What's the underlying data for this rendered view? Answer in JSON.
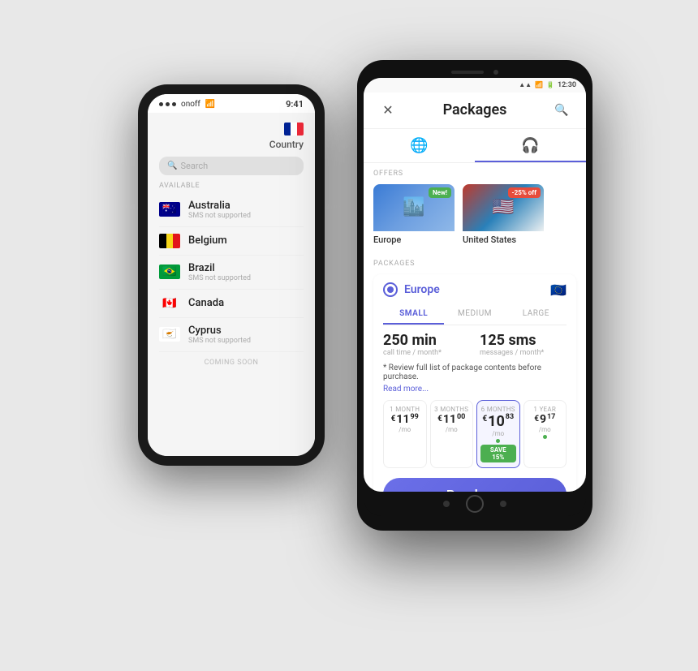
{
  "background": "#e8e8e8",
  "iphone": {
    "status": {
      "dots": 3,
      "carrier": "onoff",
      "wifi": true,
      "time": "9:41"
    },
    "header": {
      "country_label": "Country"
    },
    "search": {
      "placeholder": "Search"
    },
    "sections": {
      "available": "AVAILABLE",
      "coming_soon": "COMING SOON"
    },
    "countries": [
      {
        "name": "Australia",
        "sub": "SMS not supported",
        "flag": "au"
      },
      {
        "name": "Belgium",
        "sub": "",
        "flag": "be"
      },
      {
        "name": "Brazil",
        "sub": "SMS not supported",
        "flag": "br"
      },
      {
        "name": "Canada",
        "sub": "",
        "flag": "ca"
      },
      {
        "name": "Cyprus",
        "sub": "SMS not supported",
        "flag": "cy"
      }
    ]
  },
  "android": {
    "status": {
      "time": "12:30",
      "icons": [
        "signal",
        "wifi",
        "battery"
      ]
    },
    "nav": {
      "title": "Packages",
      "close_icon": "✕",
      "search_icon": "🔍"
    },
    "tabs": [
      {
        "id": "globe",
        "icon": "🌐",
        "active": false
      },
      {
        "id": "headset",
        "icon": "🎧",
        "active": true
      }
    ],
    "offers": {
      "section_label": "OFFERS",
      "items": [
        {
          "name": "Europe",
          "badge": "New!",
          "badge_type": "new",
          "bg": "europe"
        },
        {
          "name": "United States",
          "badge": "-25% off",
          "badge_type": "discount",
          "bg": "us"
        }
      ]
    },
    "packages": {
      "section_label": "PACKAGES",
      "selected": "Europe",
      "sizes": [
        "SMALL",
        "MEDIUM",
        "LARGE"
      ],
      "active_size": "SMALL",
      "stats": [
        {
          "value": "250 min",
          "label": "call time / month*"
        },
        {
          "value": "125 sms",
          "label": "messages / month*"
        }
      ],
      "note": "* Review full list of package contents before purchase.",
      "read_more": "Read more...",
      "pricing": [
        {
          "duration": "1 MONTH",
          "currency": "€",
          "main": "11",
          "decimal": "99",
          "sub": "/mo",
          "selected": false,
          "dot": false,
          "save": ""
        },
        {
          "duration": "3 MONTHS",
          "currency": "€",
          "main": "11",
          "decimal": "00",
          "sub": "/mo",
          "selected": false,
          "dot": false,
          "save": ""
        },
        {
          "duration": "6 MONTHS",
          "currency": "€",
          "main": "10",
          "decimal": "83",
          "sub": "/mo",
          "selected": true,
          "dot": true,
          "save": "SAVE 15%"
        },
        {
          "duration": "1 YEAR",
          "currency": "€",
          "main": "9",
          "decimal": "17",
          "sub": "/mo",
          "selected": false,
          "dot": true,
          "save": ""
        }
      ],
      "purchase_btn": "Purchase"
    }
  }
}
